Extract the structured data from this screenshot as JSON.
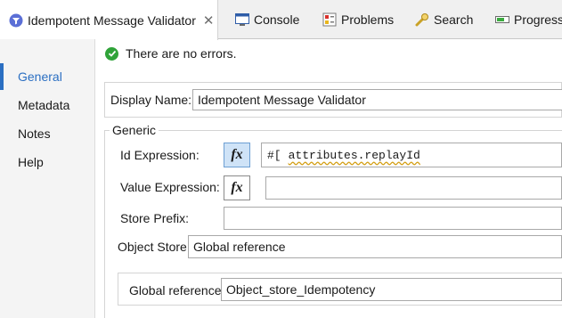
{
  "tabs": [
    {
      "label": "Idempotent Message Validator",
      "icon": "filter-icon",
      "active": true
    },
    {
      "label": "Console",
      "icon": "console-icon"
    },
    {
      "label": "Problems",
      "icon": "problems-icon"
    },
    {
      "label": "Search",
      "icon": "search-icon"
    },
    {
      "label": "Progress",
      "icon": "progress-icon"
    }
  ],
  "nav": {
    "items": [
      "General",
      "Metadata",
      "Notes",
      "Help"
    ],
    "selected": "General"
  },
  "status": {
    "text": "There are no errors."
  },
  "display_name": {
    "label": "Display Name:",
    "value": "Idempotent Message Validator"
  },
  "generic": {
    "legend": "Generic",
    "id_expression": {
      "label": "Id Expression:",
      "prefix": "#[",
      "value": "attributes.replayId"
    },
    "value_expression": {
      "label": "Value Expression:",
      "value": ""
    },
    "store_prefix": {
      "label": "Store Prefix:",
      "value": ""
    },
    "object_store": {
      "label": "Object Store",
      "value": "Global reference"
    },
    "global_reference": {
      "label": "Global reference:",
      "value": "Object_store_Idempotency"
    }
  },
  "fx_label": "fx",
  "colors": {
    "accent": "#2b6fc2",
    "ok_green": "#2fa339",
    "fx_active_bg": "#cfe3f7"
  }
}
